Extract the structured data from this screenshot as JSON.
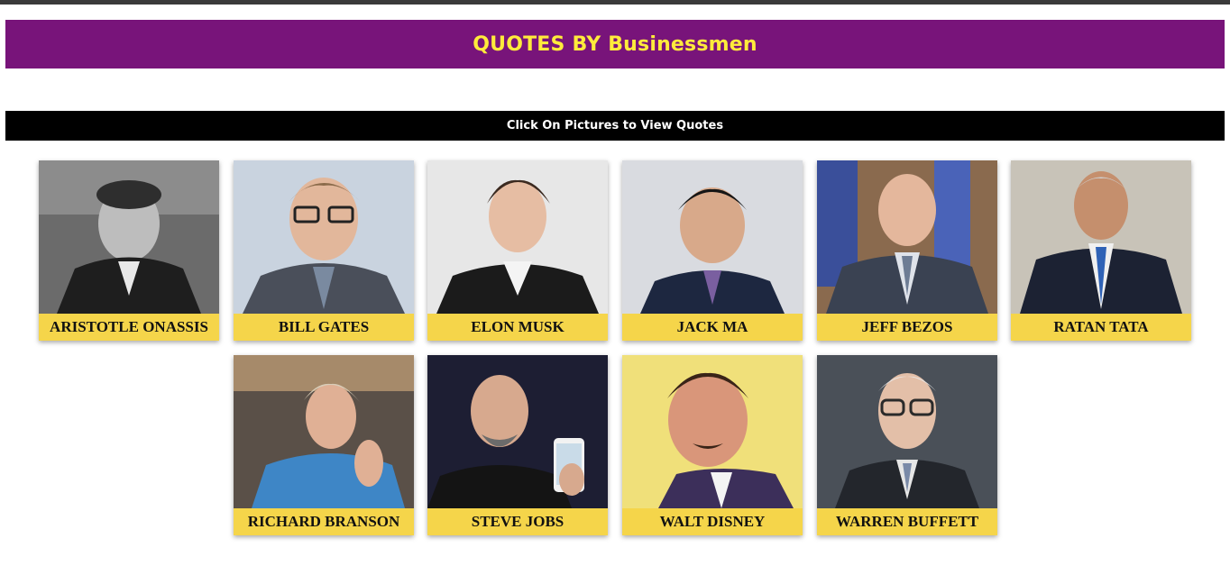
{
  "header": {
    "title": "QUOTES BY Businessmen"
  },
  "instruction": {
    "text": "Click On Pictures to View Quotes"
  },
  "colors": {
    "header_bg": "#78147a",
    "header_text": "#ffeb3b",
    "instruction_bg": "#000000",
    "label_bg": "#f5d54a"
  },
  "people": [
    {
      "name": "ARISTOTLE ONASSIS"
    },
    {
      "name": "BILL GATES"
    },
    {
      "name": "ELON MUSK"
    },
    {
      "name": "JACK MA"
    },
    {
      "name": "JEFF BEZOS"
    },
    {
      "name": "RATAN TATA"
    },
    {
      "name": "RICHARD BRANSON"
    },
    {
      "name": "STEVE JOBS"
    },
    {
      "name": "WALT DISNEY"
    },
    {
      "name": "WARREN BUFFETT"
    }
  ]
}
